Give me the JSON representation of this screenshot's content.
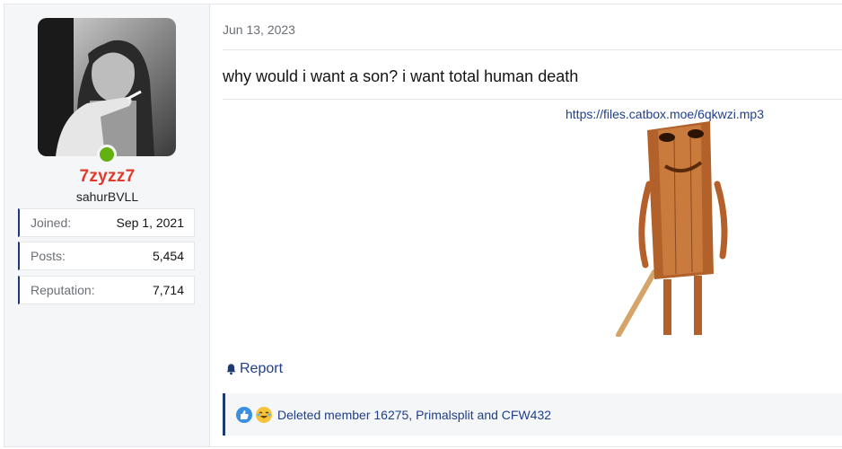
{
  "user": {
    "username": "7zyzz7",
    "title": "sahurBVLL",
    "online": true,
    "stats": [
      {
        "label": "Joined:",
        "value": "Sep 1, 2021"
      },
      {
        "label": "Posts:",
        "value": "5,454"
      },
      {
        "label": "Reputation:",
        "value": "7,714"
      }
    ]
  },
  "post": {
    "date": "Jun 13, 2023",
    "message": "why would i want a son? i want total human death",
    "link": "https://files.catbox.moe/6qkwzi.mp3",
    "report_label": "Report"
  },
  "reactions": {
    "icons": [
      "like-icon",
      "laugh-icon"
    ],
    "text": "Deleted member 16275, Primalsplit and CFW432"
  },
  "colors": {
    "username": "#e2392b",
    "link": "#1f3f8a",
    "accent": "#1e3a6e",
    "online": "#63b111"
  }
}
